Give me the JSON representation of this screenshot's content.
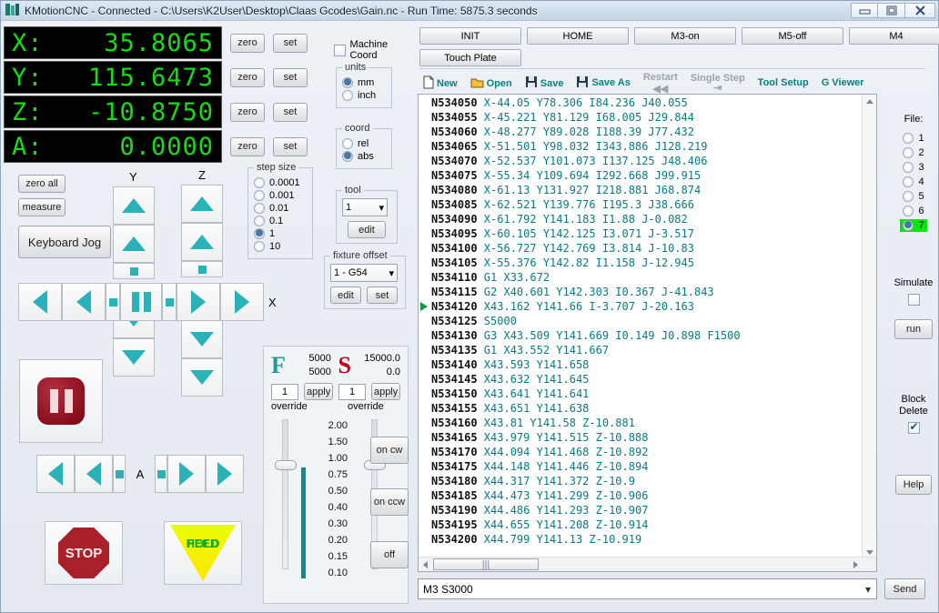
{
  "window": {
    "title": "KMotionCNC - Connected - C:\\Users\\K2User\\Desktop\\Claas Gcodes\\Gain.nc  -  Run Time:   5875.3 seconds",
    "minimize": "—",
    "restore": "❐",
    "close": "✕"
  },
  "dro": {
    "axes": [
      {
        "label": "X:",
        "value": "35.8065",
        "zero": "zero",
        "set": "set"
      },
      {
        "label": "Y:",
        "value": "115.6473",
        "zero": "zero",
        "set": "set"
      },
      {
        "label": "Z:",
        "value": "-10.8750",
        "zero": "zero",
        "set": "set"
      },
      {
        "label": "A:",
        "value": "0.0000",
        "zero": "zero",
        "set": "set"
      }
    ],
    "color": "#15dd15"
  },
  "left_controls": {
    "zero_all": "zero all",
    "measure": "measure",
    "keyboard_jog": "Keyboard Jog",
    "machine_coord_label": "Machine Coord",
    "machine_coord_checked": false,
    "axis_y_label": "Y",
    "axis_z_label": "Z",
    "axis_x_label": "X",
    "axis_a_label": "A",
    "stop": "STOP",
    "feed_hold_line1": "FEED",
    "feed_hold_line2": "HOLD"
  },
  "units": {
    "legend": "units",
    "options": [
      "mm",
      "inch"
    ],
    "selected": "mm"
  },
  "coord": {
    "legend": "coord",
    "options": [
      "rel",
      "abs"
    ],
    "selected": "abs"
  },
  "tool": {
    "legend": "tool",
    "value": "1",
    "edit": "edit"
  },
  "fixture_offset": {
    "legend": "fixture offset",
    "value": "1 - G54",
    "edit": "edit",
    "set": "set"
  },
  "step_size": {
    "legend": "step size",
    "options": [
      "0.0001",
      "0.001",
      "0.01",
      "0.1",
      "1",
      "10"
    ],
    "selected": "1"
  },
  "feed_spindle": {
    "feed_letter": "F",
    "feed_color": "#1f9c96",
    "feed_commanded": "5000",
    "feed_actual": "5000",
    "spindle_letter": "S",
    "spindle_color": "#c00018",
    "spindle_commanded": "15000.0",
    "spindle_actual": "0.0",
    "feed_override_value": "1",
    "spindle_override_value": "1",
    "apply": "apply",
    "override_label": "override",
    "scale": [
      "2.00",
      "1.50",
      "1.00",
      "0.75",
      "0.50",
      "0.40",
      "0.30",
      "0.20",
      "0.15",
      "0.10"
    ],
    "spindle_on_cw": "on cw",
    "spindle_on_ccw": "on ccw",
    "spindle_off": "off"
  },
  "toolbar": {
    "row1": [
      "INIT",
      "HOME",
      "M3-on",
      "M5-off",
      "M4"
    ],
    "touch_plate": "Touch Plate",
    "items": [
      {
        "label": "New",
        "icon": "new-file-icon",
        "disabled": false
      },
      {
        "label": "Open",
        "icon": "open-folder-icon",
        "disabled": false
      },
      {
        "label": "Save",
        "icon": "save-disk-icon",
        "disabled": false
      },
      {
        "label": "Save As",
        "icon": "save-as-disk-icon",
        "disabled": false
      },
      {
        "label": "Restart",
        "icon": "restart-icon",
        "disabled": true
      },
      {
        "label": "Single Step",
        "icon": "single-step-icon",
        "disabled": true
      },
      {
        "label": "Tool Setup",
        "icon": "tool-setup-icon",
        "disabled": false
      },
      {
        "label": "G Viewer",
        "icon": "g-viewer-icon",
        "disabled": false
      }
    ]
  },
  "gcode": {
    "current_line_index": 14,
    "lines": [
      {
        "n": "N534050",
        "code": "X-44.05 Y78.306 I84.236 J40.055"
      },
      {
        "n": "N534055",
        "code": "X-45.221 Y81.129 I68.005 J29.844"
      },
      {
        "n": "N534060",
        "code": "X-48.277 Y89.028 I188.39 J77.432"
      },
      {
        "n": "N534065",
        "code": "X-51.501 Y98.032 I343.886 J128.219"
      },
      {
        "n": "N534070",
        "code": "X-52.537 Y101.073 I137.125 J48.406"
      },
      {
        "n": "N534075",
        "code": "X-55.34 Y109.694 I292.668 J99.915"
      },
      {
        "n": "N534080",
        "code": "X-61.13 Y131.927 I218.881 J68.874"
      },
      {
        "n": "N534085",
        "code": "X-62.521 Y139.776 I195.3 J38.666"
      },
      {
        "n": "N534090",
        "code": "X-61.792 Y141.183 I1.88 J-0.082"
      },
      {
        "n": "N534095",
        "code": "X-60.105 Y142.125 I3.071 J-3.517"
      },
      {
        "n": "N534100",
        "code": "X-56.727 Y142.769 I3.814 J-10.83"
      },
      {
        "n": "N534105",
        "code": "X-55.376 Y142.82 I1.158 J-12.945"
      },
      {
        "n": "N534110",
        "code": "G1 X33.672"
      },
      {
        "n": "N534115",
        "code": "G2 X40.601 Y142.303 I0.367 J-41.843"
      },
      {
        "n": "N534120",
        "code": "X43.162 Y141.66 I-3.707 J-20.163"
      },
      {
        "n": "N534125",
        "code": "S5000"
      },
      {
        "n": "N534130",
        "code": "G3 X43.509 Y141.669 I0.149 J0.898 F1500"
      },
      {
        "n": "N534135",
        "code": "G1 X43.552 Y141.667"
      },
      {
        "n": "N534140",
        "code": "X43.593 Y141.658"
      },
      {
        "n": "N534145",
        "code": "X43.632 Y141.645"
      },
      {
        "n": "N534150",
        "code": "X43.641 Y141.641"
      },
      {
        "n": "N534155",
        "code": "X43.651 Y141.638"
      },
      {
        "n": "N534160",
        "code": "X43.81 Y141.58 Z-10.881"
      },
      {
        "n": "N534165",
        "code": "X43.979 Y141.515 Z-10.888"
      },
      {
        "n": "N534170",
        "code": "X44.094 Y141.468 Z-10.892"
      },
      {
        "n": "N534175",
        "code": "X44.148 Y141.446 Z-10.894"
      },
      {
        "n": "N534180",
        "code": "X44.317 Y141.372 Z-10.9"
      },
      {
        "n": "N534185",
        "code": "X44.473 Y141.299 Z-10.906"
      },
      {
        "n": "N534190",
        "code": "X44.486 Y141.293 Z-10.907"
      },
      {
        "n": "N534195",
        "code": "X44.655 Y141.208 Z-10.914"
      },
      {
        "n": "N534200",
        "code": "X44.799 Y141.13 Z-10.919"
      }
    ]
  },
  "file_panel": {
    "label": "File:",
    "options": [
      "1",
      "2",
      "3",
      "4",
      "5",
      "6",
      "7"
    ],
    "selected": "7",
    "highlight_color": "#00e800",
    "simulate_label": "Simulate",
    "simulate_checked": false,
    "run": "run",
    "block_delete_line1": "Block",
    "block_delete_line2": "Delete",
    "block_delete_checked": true,
    "help": "Help"
  },
  "mdi": {
    "value": "M3 S3000",
    "send": "Send"
  }
}
